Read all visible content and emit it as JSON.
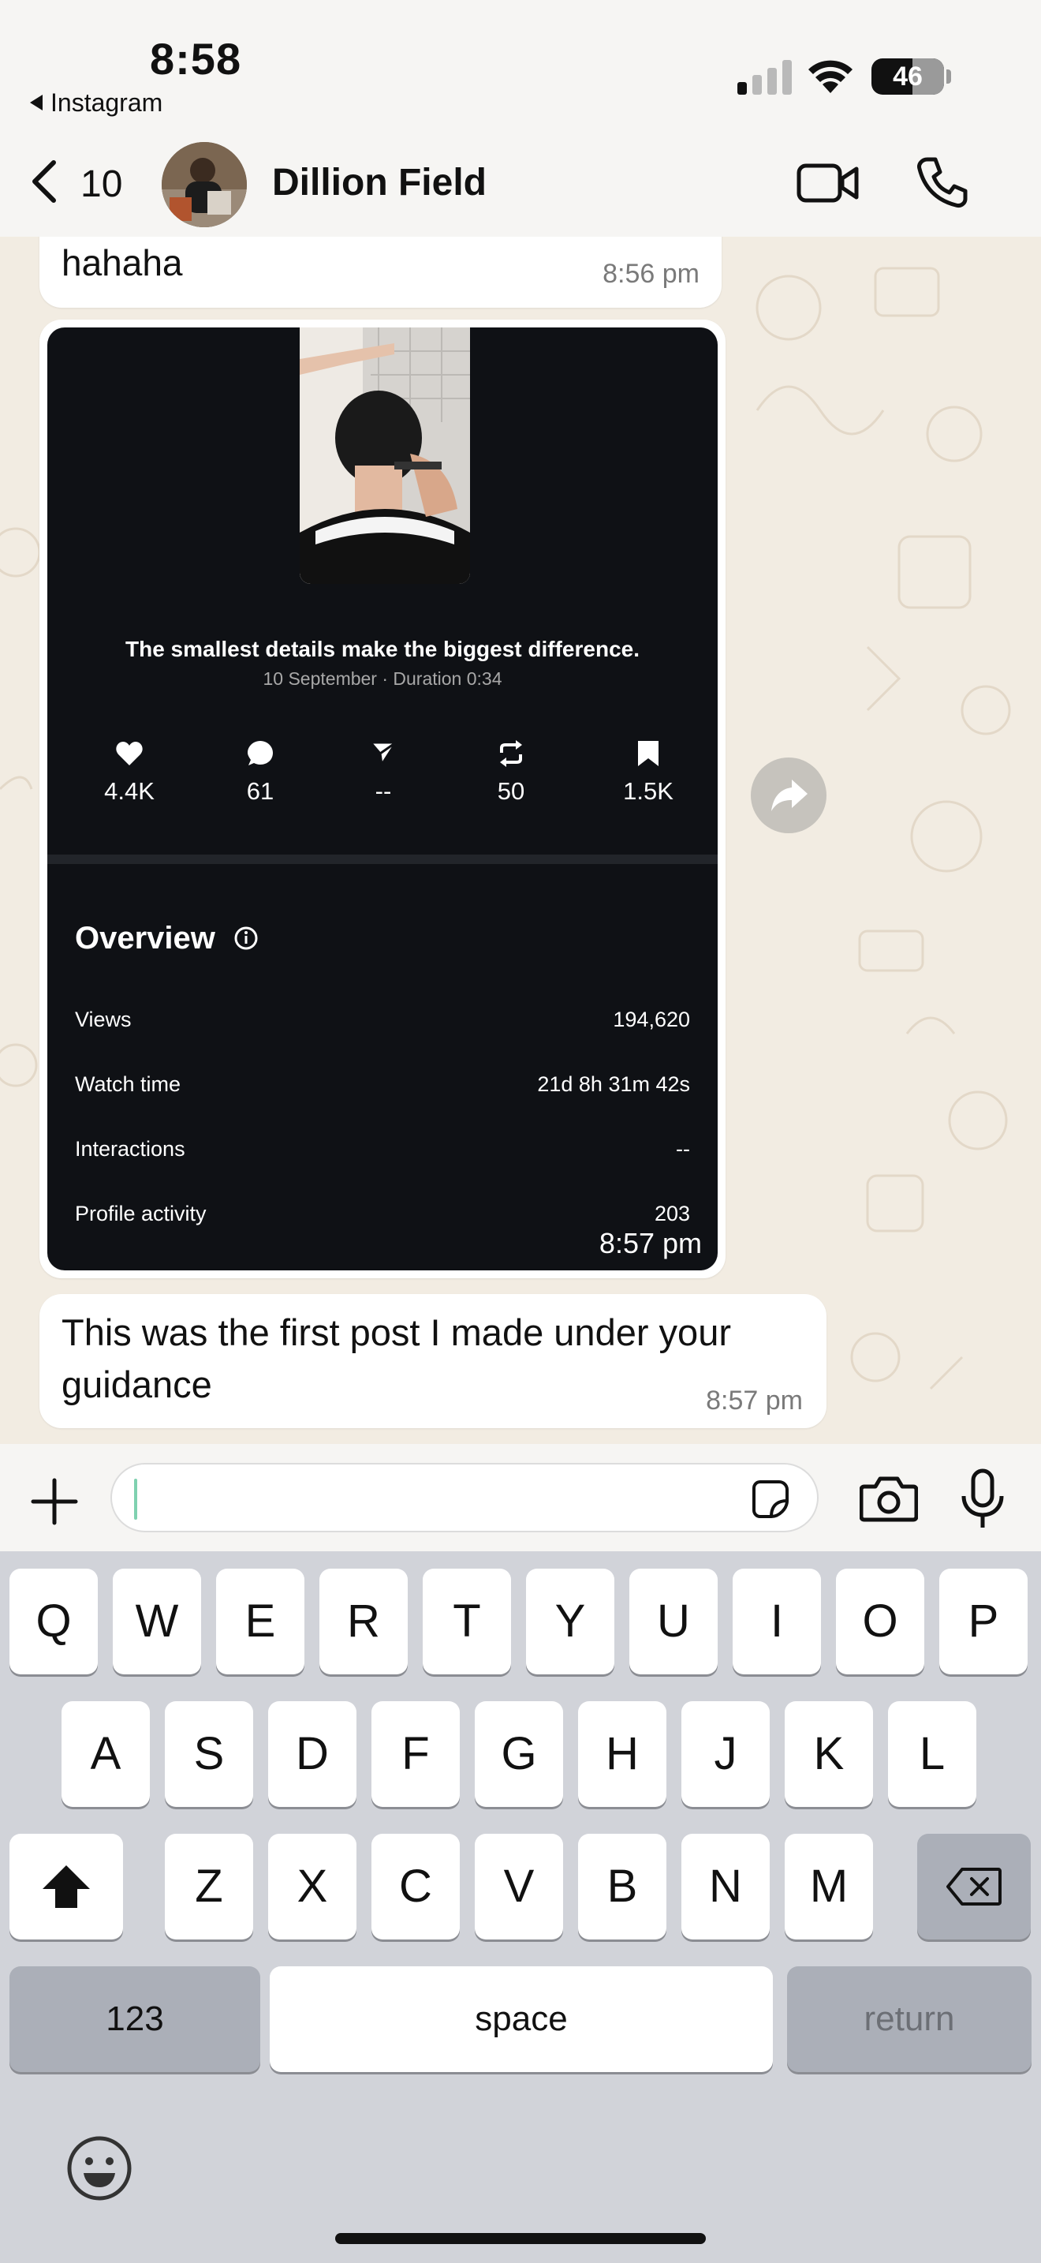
{
  "status_bar": {
    "time": "8:58",
    "back_app": "Instagram",
    "battery": "46"
  },
  "header": {
    "unread_count": "10",
    "contact_name": "Dillion Field"
  },
  "messages": [
    {
      "text": "hahaha",
      "time": "8:56 pm"
    },
    {
      "post": {
        "caption": "The smallest details make the biggest difference.",
        "date_line": "10 September · Duration 0:34",
        "stats": [
          {
            "icon": "heart-icon",
            "value": "4.4K"
          },
          {
            "icon": "comment-icon",
            "value": "61"
          },
          {
            "icon": "send-icon",
            "value": "--"
          },
          {
            "icon": "repost-icon",
            "value": "50"
          },
          {
            "icon": "bookmark-icon",
            "value": "1.5K"
          }
        ],
        "overview_title": "Overview",
        "rows": [
          {
            "label": "Views",
            "value": "194,620"
          },
          {
            "label": "Watch time",
            "value": "21d 8h 31m 42s"
          },
          {
            "label": "Interactions",
            "value": "--"
          },
          {
            "label": "Profile activity",
            "value": "203"
          }
        ]
      },
      "time": "8:57 pm"
    },
    {
      "text": "This was the first post I made under your guidance",
      "time": "8:57 pm"
    }
  ],
  "input": {
    "value": ""
  },
  "keyboard": {
    "row1": [
      "Q",
      "W",
      "E",
      "R",
      "T",
      "Y",
      "U",
      "I",
      "O",
      "P"
    ],
    "row2": [
      "A",
      "S",
      "D",
      "F",
      "G",
      "H",
      "J",
      "K",
      "L"
    ],
    "row3": [
      "Z",
      "X",
      "C",
      "V",
      "B",
      "N",
      "M"
    ],
    "numbers_label": "123",
    "space_label": "space",
    "return_label": "return"
  },
  "colors": {
    "chat_bg": "#f2ece2",
    "card_bg": "#0f1115",
    "keyboard_bg": "#d1d3d9",
    "cursor": "#7fd1b0"
  }
}
